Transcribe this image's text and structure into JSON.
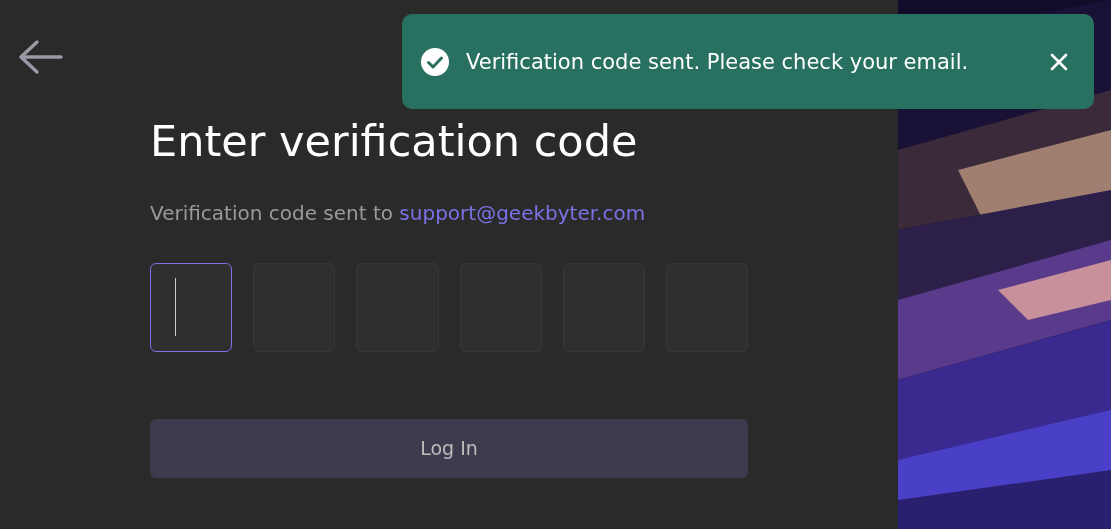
{
  "toast": {
    "kind": "success",
    "message": "Verification code sent. Please check your email."
  },
  "heading": "Enter verification code",
  "subtitle": {
    "text": "Verification code sent to",
    "email": "support@geekbyter.com"
  },
  "code_boxes": [
    {
      "selected": true
    },
    {
      "selected": false
    },
    {
      "selected": false
    },
    {
      "selected": false
    },
    {
      "selected": false
    },
    {
      "selected": false
    }
  ],
  "login_button": {
    "label": "Log In",
    "disabled": true
  }
}
